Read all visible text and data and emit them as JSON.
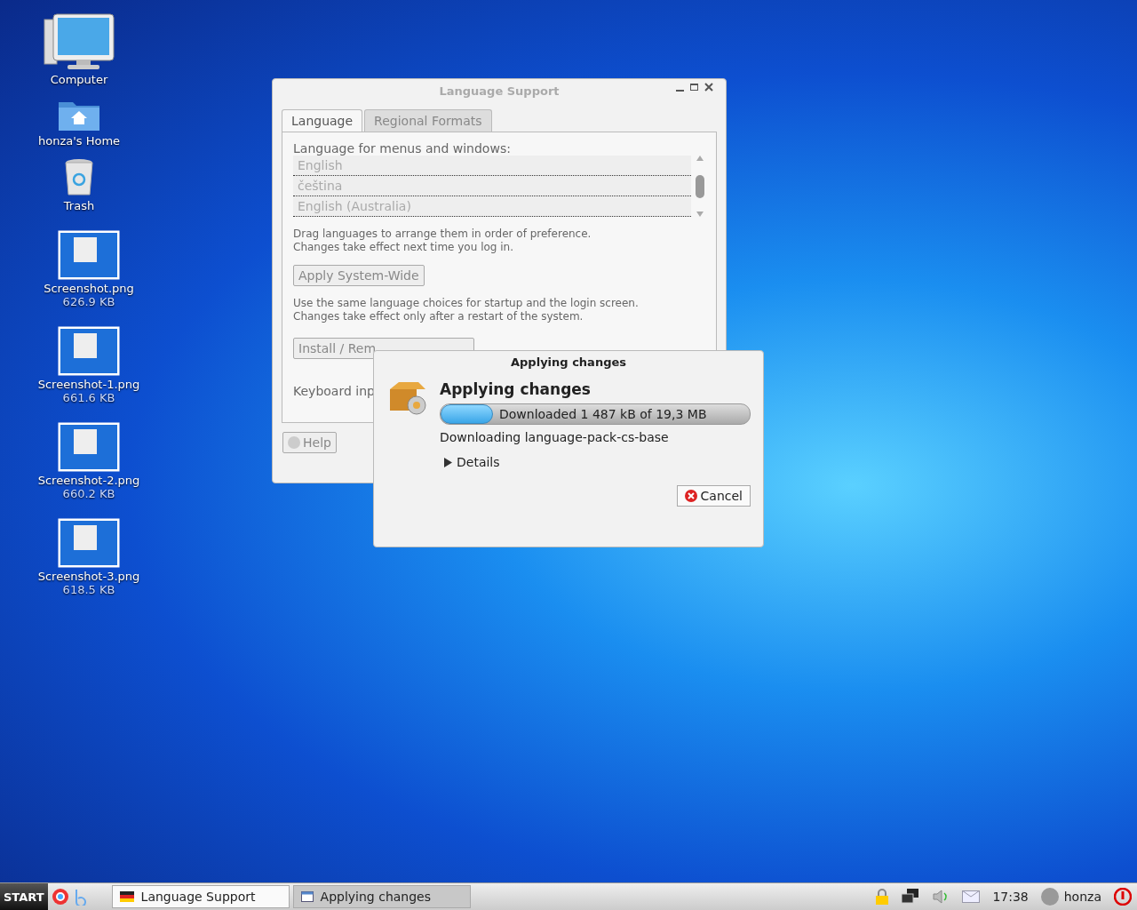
{
  "desktop_icons": [
    {
      "kind": "computer",
      "label": "Computer"
    },
    {
      "kind": "home",
      "label": "honza's Home"
    },
    {
      "kind": "trash",
      "label": "Trash"
    },
    {
      "kind": "image",
      "label": "Screenshot.png",
      "size": "626.9 KB"
    },
    {
      "kind": "image",
      "label": "Screenshot-1.png",
      "size": "661.6 KB"
    },
    {
      "kind": "image",
      "label": "Screenshot-2.png",
      "size": "660.2 KB"
    },
    {
      "kind": "image",
      "label": "Screenshot-3.png",
      "size": "618.5 KB"
    }
  ],
  "language_window": {
    "title": "Language Support",
    "tabs": [
      {
        "label": "Language",
        "selected": true
      },
      {
        "label": "Regional Formats",
        "selected": false
      }
    ],
    "list_label": "Language for menus and windows:",
    "languages": [
      "English",
      "čeština",
      "English (Australia)"
    ],
    "hint": [
      "Drag languages to arrange them in order of preference.",
      "Changes take effect next time you log in."
    ],
    "apply_button": "Apply System-Wide",
    "apply_hint": [
      "Use the same language choices for startup and the login screen.",
      "Changes take effect only after a restart of the system."
    ],
    "install_button": "Install / Rem",
    "keyboard_label": "Keyboard inp",
    "help_button": "Help"
  },
  "progress_dialog": {
    "title": "Applying changes",
    "heading": "Applying changes",
    "level": 0.17,
    "progress_text": "Downloaded 1 487 kB of 19,3 MB",
    "status": "Downloading language-pack-cs-base",
    "details": {
      "label": "Details",
      "expanded": false
    },
    "cancel_button": "Cancel"
  },
  "taskbar": {
    "start": "START",
    "tasks": [
      {
        "label": "Language Support",
        "kind": "flag",
        "selected": false
      },
      {
        "label": "Applying changes",
        "kind": "window",
        "selected": true
      }
    ],
    "clock": "17:38",
    "user": "honza"
  }
}
